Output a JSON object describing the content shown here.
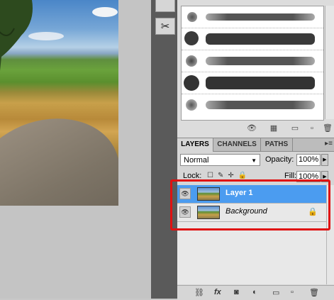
{
  "toolbar": {
    "tool_icon": "scissors-brush-icon"
  },
  "brushes": {
    "rows": 5,
    "footer_icons": [
      "eye-brush-icon",
      "grid-icon",
      "frame-icon",
      "new-icon",
      "trash-icon"
    ]
  },
  "layers_panel": {
    "tabs": [
      {
        "label": "LAYERS",
        "active": true
      },
      {
        "label": "CHANNELS",
        "active": false
      },
      {
        "label": "PATHS",
        "active": false
      }
    ],
    "menu_icon": "▸≡",
    "blend_mode": "Normal",
    "opacity_label": "Opacity:",
    "opacity_value": "100%",
    "lock_label": "Lock:",
    "lock_icons": "☐✎✛🔒",
    "fill_label": "Fill:",
    "fill_value": "100%",
    "layers": [
      {
        "name": "Layer 1",
        "selected": true,
        "locked": false
      },
      {
        "name": "Background",
        "selected": false,
        "locked": true
      }
    ],
    "footer_icons": [
      "link-icon",
      "fx-icon",
      "mask-icon",
      "adjustment-icon",
      "folder-icon",
      "new-layer-icon",
      "trash-icon"
    ]
  },
  "colors": {
    "selected_layer": "#4b9cf0",
    "highlight_box": "#e01010"
  }
}
